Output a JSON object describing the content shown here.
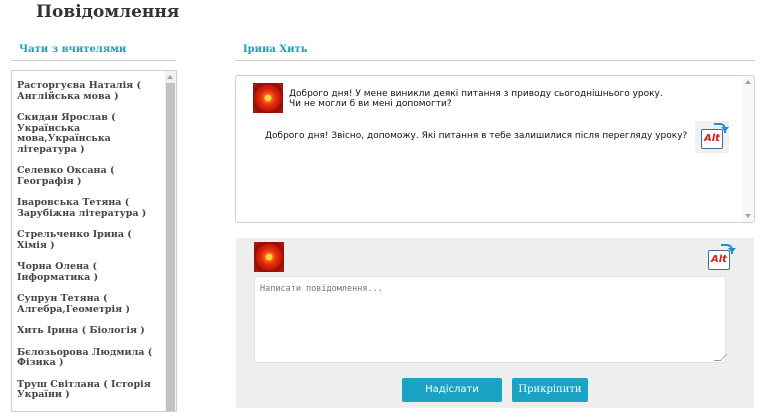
{
  "page": {
    "title": "Повідомлення"
  },
  "sidebar": {
    "heading": "Чати з вчителями",
    "items": [
      {
        "label": "Расторгуєва Наталія ( Англійська мова )"
      },
      {
        "label": "Скидан Ярослав ( Українська мова,Українська література )"
      },
      {
        "label": "Селевко Оксана ( Географія )"
      },
      {
        "label": "Іваровська Тетяна ( Зарубіжна література )"
      },
      {
        "label": "Стрельченко Ірина ( Хімія )"
      },
      {
        "label": "Чорна Олена ( Інформатика )"
      },
      {
        "label": "Супрун Тетяна ( Алгебра,Геометрія )"
      },
      {
        "label": "Хить Ірина ( Біологія )"
      },
      {
        "label": "Бєлозьорова Людмила ( Фізика )"
      },
      {
        "label": "Труш Світлана ( Історія України )"
      }
    ]
  },
  "chat": {
    "contact_name": "Ірина Хить",
    "messages": [
      {
        "side": "incoming",
        "line1": "Доброго дня! У мене виникли деякі питання з приводу сьогоднішнього уроку.",
        "line2": "Чи не могли б ви мені допомогти?"
      },
      {
        "side": "outgoing",
        "line1": "Доброго дня! Звісно, допоможу. Які питання в тебе залишилися після перегляду уроку?"
      }
    ]
  },
  "compose": {
    "placeholder": "Написати повідомлення...",
    "send_label": "Надіслати",
    "attach_label": "Прикріпити"
  },
  "icons": {
    "avatar": "red-flower-avatar",
    "alt_icon": "alt-text-icon",
    "alt_text": "Alt"
  },
  "colors": {
    "accent": "#17a2b8",
    "button": "#1aa3c2"
  }
}
